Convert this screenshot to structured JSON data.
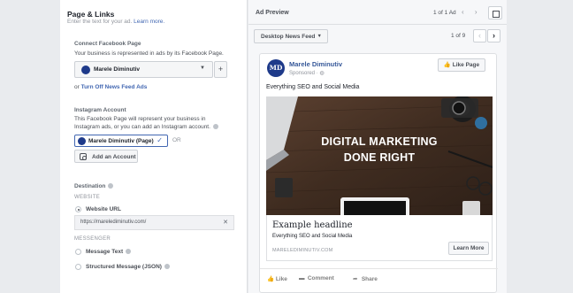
{
  "left": {
    "title": "Page & Links",
    "subtitle": "Enter the text for your ad.",
    "learn_more": "Learn more.",
    "facebook_page": {
      "label": "Connect Facebook Page",
      "helper": "Your business is represented in ads by its Facebook Page.",
      "selected": "Marele Diminutiv",
      "add_symbol": "+",
      "or_text": "or",
      "turn_off": "Turn Off News Feed Ads"
    },
    "instagram": {
      "label": "Instagram Account",
      "helper_line1": "This Facebook Page will represent your business in",
      "helper_line2": "Instagram ads, or you can add an Instagram account.",
      "selected": "Marele Diminutiv (Page)",
      "or_text": "OR",
      "add_button": "Add an Account"
    },
    "destination": {
      "label": "Destination",
      "website_caps": "WEBSITE",
      "website_option": "Website URL",
      "url_value": "https://marelediminutiv.com/",
      "messenger_caps": "MESSENGER",
      "message_text": "Message Text",
      "structured_message": "Structured Message (JSON)",
      "selected": "website"
    }
  },
  "preview": {
    "title": "Ad Preview",
    "count": "1 of 1 Ad",
    "placement": "Desktop News Feed",
    "pager": "1 of 9"
  },
  "ad": {
    "page_name": "Marele Diminutiv",
    "avatar_text": "MD",
    "sponsored": "Sponsored · ",
    "like_page": "Like Page",
    "primary_text": "Everything SEO and Social Media",
    "image_line1": "DIGITAL MARKETING",
    "image_line2": "DONE RIGHT",
    "headline": "Example headline",
    "description": "Everything SEO and Social Media",
    "domain": "MARELEDIMINUTIV.COM",
    "cta": "Learn More",
    "actions": [
      "Like",
      "Comment",
      "Share"
    ]
  },
  "colors": {
    "accent": "#4267b2",
    "page_bg": "#e9ebee",
    "avatar": "#1e3a8a"
  }
}
